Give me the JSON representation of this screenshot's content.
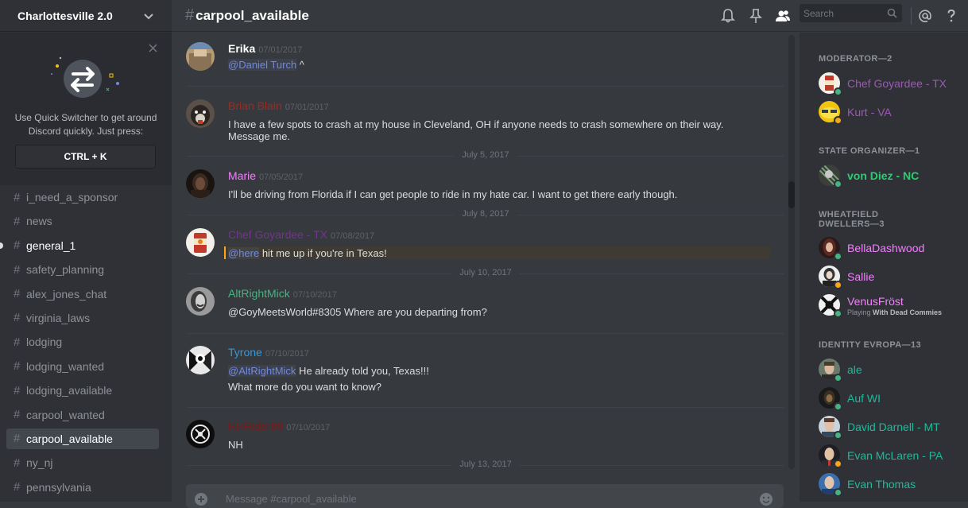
{
  "sidebar": {
    "server_name": "Charlottesville 2.0",
    "quick_switcher": {
      "text": "Use Quick Switcher to get around Discord quickly. Just press:",
      "shortcut": "CTRL + K"
    },
    "channels": [
      {
        "name": "i_need_a_sponsor",
        "state": "normal"
      },
      {
        "name": "news",
        "state": "normal"
      },
      {
        "name": "general_1",
        "state": "unread"
      },
      {
        "name": "safety_planning",
        "state": "normal"
      },
      {
        "name": "alex_jones_chat",
        "state": "normal"
      },
      {
        "name": "virginia_laws",
        "state": "normal"
      },
      {
        "name": "lodging",
        "state": "normal"
      },
      {
        "name": "lodging_wanted",
        "state": "normal"
      },
      {
        "name": "lodging_available",
        "state": "normal"
      },
      {
        "name": "carpool_wanted",
        "state": "normal"
      },
      {
        "name": "carpool_available",
        "state": "selected"
      },
      {
        "name": "ny_nj",
        "state": "normal"
      },
      {
        "name": "pennsylvania",
        "state": "normal"
      }
    ]
  },
  "header": {
    "hash": "#",
    "channel_title": "carpool_available",
    "search_placeholder": "Search",
    "icons": [
      "bell-icon",
      "pin-icon",
      "members-icon",
      "search-icon",
      "mention-icon",
      "help-icon"
    ]
  },
  "messages": [
    {
      "author": "Erika",
      "author_color": "#ffffff",
      "timestamp": "07/01/2017",
      "mention": "@Daniel Turch",
      "text": " ^"
    },
    {
      "author": "Brian Blain",
      "author_color": "#992d22",
      "timestamp": "07/01/2017",
      "text": "I have a few spots to crash at my house in Cleveland, OH if anyone needs to crash somewhere on their way. Message me."
    },
    {
      "author": "Marie",
      "author_color": "#f47fff",
      "timestamp": "07/05/2017",
      "text": "I'll be driving from Florida if I can get people to ride in my hate car. I want to get there early though."
    },
    {
      "author": "Chef Goyardee - TX",
      "author_color": "#71368a",
      "timestamp": "07/08/2017",
      "mention": "@here",
      "text": " hit me up if you're in Texas!"
    },
    {
      "author": "AltRightMick",
      "author_color": "#43b581",
      "timestamp": "07/10/2017",
      "text": "@GoyMeetsWorld#8305 Where are you departing from?"
    },
    {
      "author": "Tyrone",
      "author_color": "#3498db",
      "timestamp": "07/10/2017",
      "mention": "@AltRightMick",
      "text": " He already told you, Texas!!!",
      "text2": "What more do you want to know?"
    },
    {
      "author": "NHRider88",
      "author_color": "#7b1a1a",
      "timestamp": "07/10/2017",
      "text": "NH"
    }
  ],
  "date_separators": [
    "July 5, 2017",
    "July 8, 2017",
    "July 10, 2017",
    "July 13, 2017"
  ],
  "composer": {
    "placeholder": "Message #carpool_available"
  },
  "members": {
    "roles": [
      {
        "header": "MODERATOR—2",
        "members": [
          {
            "name": "Chef Goyardee - TX",
            "color": "#9b59b6",
            "status": "online"
          },
          {
            "name": "Kurt - VA",
            "color": "#9b59b6",
            "status": "idle"
          }
        ]
      },
      {
        "header": "STATE ORGANIZER—1",
        "members": [
          {
            "name": "von Diez - NC",
            "color": "#2ecc71",
            "status": "online"
          }
        ]
      },
      {
        "header": "WHEATFIELD DWELLERS—3",
        "members": [
          {
            "name": "BellaDashwood",
            "color": "#f47fff",
            "status": "online"
          },
          {
            "name": "Sallie",
            "color": "#f47fff",
            "status": "idle"
          },
          {
            "name": "VenusFröst",
            "color": "#f47fff",
            "status": "online",
            "activity_prefix": "Playing ",
            "activity": "With Dead Commies"
          }
        ]
      },
      {
        "header": "IDENTITY EVROPA—13",
        "members": [
          {
            "name": "ale",
            "color": "#1abc9c",
            "status": "online"
          },
          {
            "name": "Auf WI",
            "color": "#1abc9c",
            "status": "online"
          },
          {
            "name": "David Darnell - MT",
            "color": "#1abc9c",
            "status": "online"
          },
          {
            "name": "Evan McLaren - PA",
            "color": "#1abc9c",
            "status": "idle"
          },
          {
            "name": "Evan Thomas",
            "color": "#1abc9c",
            "status": "online"
          }
        ]
      }
    ],
    "status_colors": {
      "online": "#43b581",
      "idle": "#faa61a"
    }
  }
}
